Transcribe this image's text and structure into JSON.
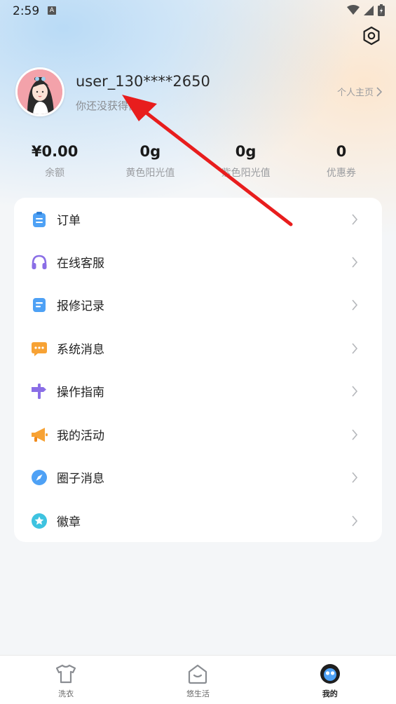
{
  "status_bar": {
    "time": "2:59",
    "notification_icon": "A"
  },
  "profile": {
    "username": "user_130****2650",
    "badge_hint": "你还没获得徽章",
    "homepage_link": "个人主页"
  },
  "stats": [
    {
      "value": "¥0.00",
      "label": "余额"
    },
    {
      "value": "0g",
      "label": "黄色阳光值"
    },
    {
      "value": "0g",
      "label": "紫色阳光值"
    },
    {
      "value": "0",
      "label": "优惠券"
    }
  ],
  "menu": [
    {
      "label": "订单",
      "icon": "clipboard-icon"
    },
    {
      "label": "在线客服",
      "icon": "headset-icon"
    },
    {
      "label": "报修记录",
      "icon": "repair-record-icon"
    },
    {
      "label": "系统消息",
      "icon": "chat-bubble-icon"
    },
    {
      "label": "操作指南",
      "icon": "signpost-icon"
    },
    {
      "label": "我的活动",
      "icon": "megaphone-icon"
    },
    {
      "label": "圈子消息",
      "icon": "compass-icon"
    },
    {
      "label": "徽章",
      "icon": "star-badge-icon"
    }
  ],
  "bottom_nav": [
    {
      "label": "洗衣",
      "icon": "shirt-icon",
      "active": false
    },
    {
      "label": "悠生活",
      "icon": "home-icon",
      "active": false
    },
    {
      "label": "我的",
      "icon": "profile-face-icon",
      "active": true
    }
  ],
  "colors": {
    "accent_blue": "#4ea1f5",
    "purple": "#8a6ee6",
    "orange": "#f7a234",
    "annotation_red": "#e81d1d"
  }
}
